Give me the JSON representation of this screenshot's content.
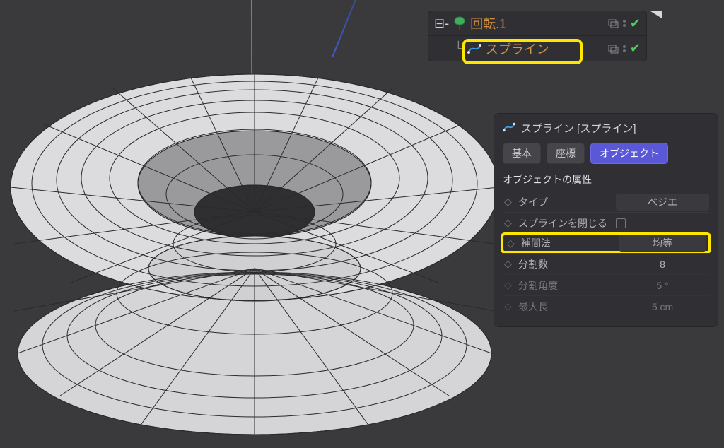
{
  "tree": {
    "item0": {
      "label": "回転.1"
    },
    "item1": {
      "label": "スプライン"
    }
  },
  "panel": {
    "header": "スプライン [スプライン]",
    "tabs": {
      "basic": "基本",
      "coord": "座標",
      "object": "オブジェクト"
    },
    "section": "オブジェクトの属性",
    "props": {
      "type": {
        "label": "タイプ",
        "value": "ベジエ"
      },
      "close": {
        "label": "スプラインを閉じる"
      },
      "interp": {
        "label": "補間法",
        "value": "均等"
      },
      "subdiv": {
        "label": "分割数",
        "value": "8"
      },
      "angle": {
        "label": "分割角度",
        "value": "5 °"
      },
      "maxlen": {
        "label": "最大長",
        "value": "5 cm"
      }
    }
  }
}
